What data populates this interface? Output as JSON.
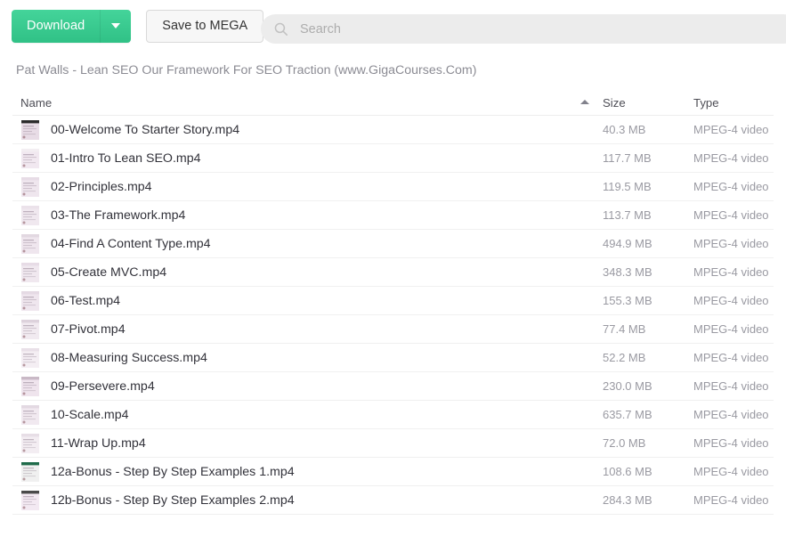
{
  "toolbar": {
    "download_label": "Download",
    "download_caret_icon": "chevron-down-icon",
    "save_to_mega_label": "Save to MEGA",
    "accent_color": "#30c186"
  },
  "search": {
    "icon": "search-icon",
    "placeholder": "Search",
    "value": ""
  },
  "breadcrumb": {
    "text": "Pat Walls - Lean SEO Our Framework For SEO Traction (www.GigaCourses.Com)"
  },
  "table": {
    "columns": {
      "name": "Name",
      "size": "Size",
      "type": "Type"
    },
    "sort": {
      "column": "Name",
      "direction": "ascending",
      "icon": "caret-up-icon"
    },
    "rows": [
      {
        "name": "00-Welcome To Starter Story.mp4",
        "size": "40.3 MB",
        "type": "MPEG-4 video",
        "thumb": "video-thumbnail",
        "thumb_tint": "#e8dce6",
        "thumb_bar": "#2b2b2b"
      },
      {
        "name": "01-Intro To Lean SEO.mp4",
        "size": "117.7 MB",
        "type": "MPEG-4 video",
        "thumb": "video-thumbnail",
        "thumb_tint": "#f1e8f0",
        "thumb_bar": "#f3eef2"
      },
      {
        "name": "02-Principles.mp4",
        "size": "119.5 MB",
        "type": "MPEG-4 video",
        "thumb": "video-thumbnail",
        "thumb_tint": "#efe6ee",
        "thumb_bar": "#e7dce6"
      },
      {
        "name": "03-The Framework.mp4",
        "size": "113.7 MB",
        "type": "MPEG-4 video",
        "thumb": "video-thumbnail",
        "thumb_tint": "#f0e8ef",
        "thumb_bar": "#ebe2ea"
      },
      {
        "name": "04-Find A Content Type.mp4",
        "size": "494.9 MB",
        "type": "MPEG-4 video",
        "thumb": "video-thumbnail",
        "thumb_tint": "#efe6ee",
        "thumb_bar": "#e2d8e1"
      },
      {
        "name": "05-Create MVC.mp4",
        "size": "348.3 MB",
        "type": "MPEG-4 video",
        "thumb": "video-thumbnail",
        "thumb_tint": "#f0e8ef",
        "thumb_bar": "#e7dce6"
      },
      {
        "name": "06-Test.mp4",
        "size": "155.3 MB",
        "type": "MPEG-4 video",
        "thumb": "video-thumbnail",
        "thumb_tint": "#efe6ee",
        "thumb_bar": "#e5dae4"
      },
      {
        "name": "07-Pivot.mp4",
        "size": "77.4 MB",
        "type": "MPEG-4 video",
        "thumb": "video-thumbnail",
        "thumb_tint": "#f1eaf0",
        "thumb_bar": "#ddd2dc"
      },
      {
        "name": "08-Measuring Success.mp4",
        "size": "52.2 MB",
        "type": "MPEG-4 video",
        "thumb": "video-thumbnail",
        "thumb_tint": "#f4eef3",
        "thumb_bar": "#e9e0e8"
      },
      {
        "name": "09-Persevere.mp4",
        "size": "230.0 MB",
        "type": "MPEG-4 video",
        "thumb": "video-thumbnail",
        "thumb_tint": "#efe4ed",
        "thumb_bar": "#c9b9c6"
      },
      {
        "name": "10-Scale.mp4",
        "size": "635.7 MB",
        "type": "MPEG-4 video",
        "thumb": "video-thumbnail",
        "thumb_tint": "#f1e9f0",
        "thumb_bar": "#e3d9e2"
      },
      {
        "name": "11-Wrap Up.mp4",
        "size": "72.0 MB",
        "type": "MPEG-4 video",
        "thumb": "video-thumbnail",
        "thumb_tint": "#f3edf2",
        "thumb_bar": "#e7dee6"
      },
      {
        "name": "12a-Bonus - Step By Step Examples 1.mp4",
        "size": "108.6 MB",
        "type": "MPEG-4 video",
        "thumb": "video-thumbnail",
        "thumb_tint": "#f0f0f0",
        "thumb_bar": "#1f6b4a"
      },
      {
        "name": "12b-Bonus - Step By Step Examples 2.mp4",
        "size": "284.3 MB",
        "type": "MPEG-4 video",
        "thumb": "video-thumbnail",
        "thumb_tint": "#f3e9f2",
        "thumb_bar": "#4a4a4a"
      }
    ]
  }
}
